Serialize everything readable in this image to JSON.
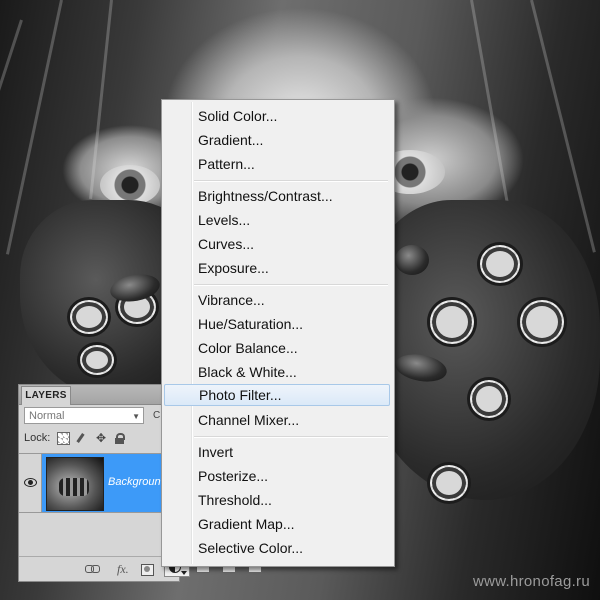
{
  "menu": {
    "items": [
      {
        "label": "Solid Color..."
      },
      {
        "label": "Gradient..."
      },
      {
        "label": "Pattern..."
      },
      {
        "label": "Brightness/Contrast..."
      },
      {
        "label": "Levels..."
      },
      {
        "label": "Curves..."
      },
      {
        "label": "Exposure..."
      },
      {
        "label": "Vibrance..."
      },
      {
        "label": "Hue/Saturation..."
      },
      {
        "label": "Color Balance..."
      },
      {
        "label": "Black & White..."
      },
      {
        "label": "Photo Filter...",
        "highlighted": true
      },
      {
        "label": "Channel Mixer..."
      },
      {
        "label": "Invert"
      },
      {
        "label": "Posterize..."
      },
      {
        "label": "Threshold..."
      },
      {
        "label": "Gradient Map..."
      },
      {
        "label": "Selective Color..."
      }
    ]
  },
  "layers_panel": {
    "tab_label": "LAYERS",
    "blend_mode": "Normal",
    "opacity_stub": "C",
    "lock_label": "Lock:",
    "layer_name": "Backgroun",
    "footer_icons": [
      "link-icon",
      "fx-icon",
      "mask-icon",
      "adjustment-layer-icon"
    ]
  },
  "watermark": "www.hronofag.ru",
  "colors": {
    "menu_bg": "#f0f0f0",
    "highlight": "#dbe9f8",
    "layer_selected": "#3d9af8"
  }
}
